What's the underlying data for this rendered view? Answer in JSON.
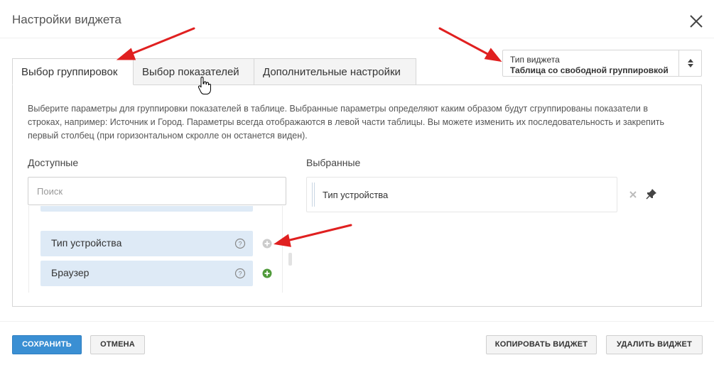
{
  "dialog": {
    "title": "Настройки виджета"
  },
  "widget_type": {
    "label": "Тип виджета",
    "value": "Таблица со свободной группировкой"
  },
  "tabs": [
    {
      "label": "Выбор группировок",
      "active": true
    },
    {
      "label": "Выбор показателей",
      "active": false
    },
    {
      "label": "Дополнительные настройки",
      "active": false
    }
  ],
  "description": "Выберите параметры для группировки показателей в таблице. Выбранные параметры определяют каким образом будут сгруппированы показатели в строках, например: Источник и Город. Параметры всегда отображаются в левой части таблицы. Вы можете изменить их последовательность и закрепить первый столбец (при горизонтальном скролле он останется виден).",
  "available": {
    "label": "Доступные",
    "search_placeholder": "Поиск",
    "items": [
      {
        "label": "Тип устройства",
        "added": true
      },
      {
        "label": "Браузер",
        "added": false
      }
    ]
  },
  "selected": {
    "label": "Выбранные",
    "items": [
      {
        "label": "Тип устройства"
      }
    ]
  },
  "footer": {
    "save": "Сохранить",
    "cancel": "Отмена",
    "copy": "Копировать виджет",
    "delete": "Удалить виджет"
  },
  "colors": {
    "primary": "#3a8fd3",
    "item_bg": "#deeaf6",
    "add_active": "#4f9a3a",
    "annotation_arrow": "#e02020"
  },
  "icons": [
    "close-icon",
    "sort-arrows-icon",
    "help-icon",
    "add-icon",
    "drag-handle-icon",
    "remove-icon",
    "pin-icon",
    "hand-cursor-icon"
  ]
}
